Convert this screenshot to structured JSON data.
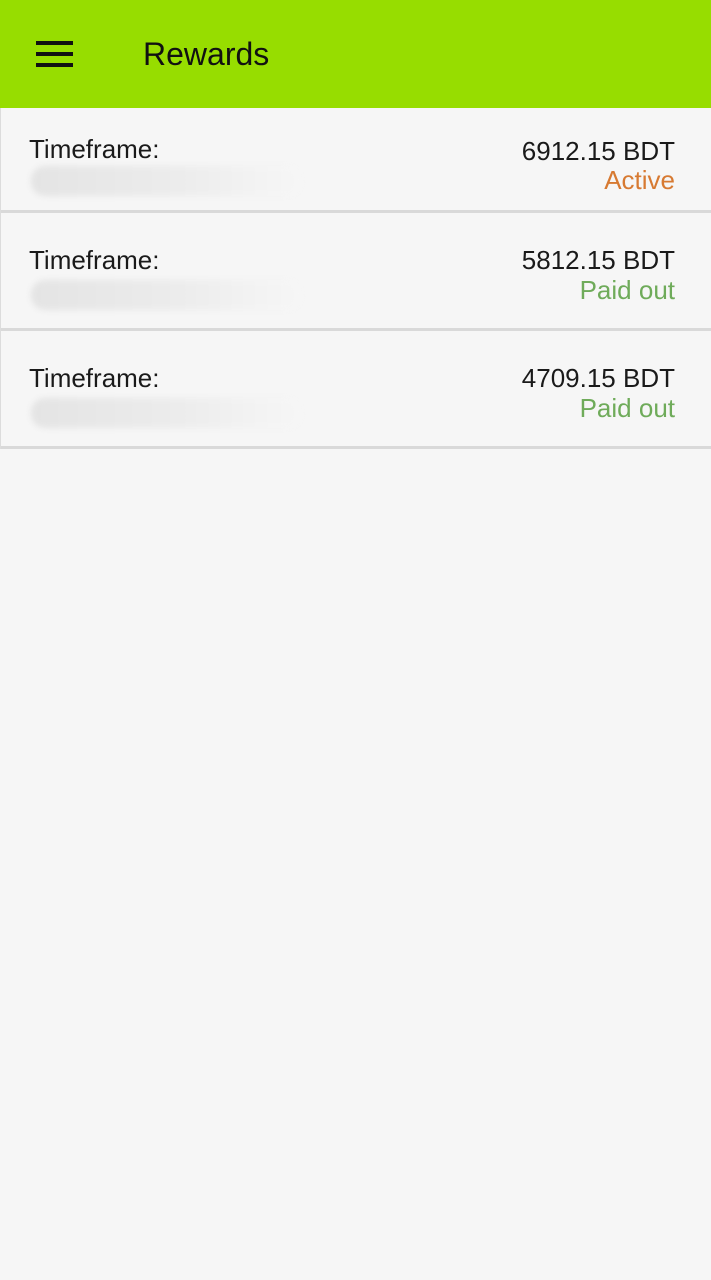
{
  "header": {
    "title": "Rewards",
    "menu_icon": "hamburger-menu-icon",
    "background_color": "#97dd00"
  },
  "rewards": [
    {
      "timeframe_label": "Timeframe:",
      "amount": "6912.15 BDT",
      "status": "Active",
      "status_color": "#d77a32"
    },
    {
      "timeframe_label": "Timeframe:",
      "amount": "5812.15 BDT",
      "status": "Paid out",
      "status_color": "#6fab5a"
    },
    {
      "timeframe_label": "Timeframe:",
      "amount": "4709.15 BDT",
      "status": "Paid out",
      "status_color": "#6fab5a"
    }
  ]
}
